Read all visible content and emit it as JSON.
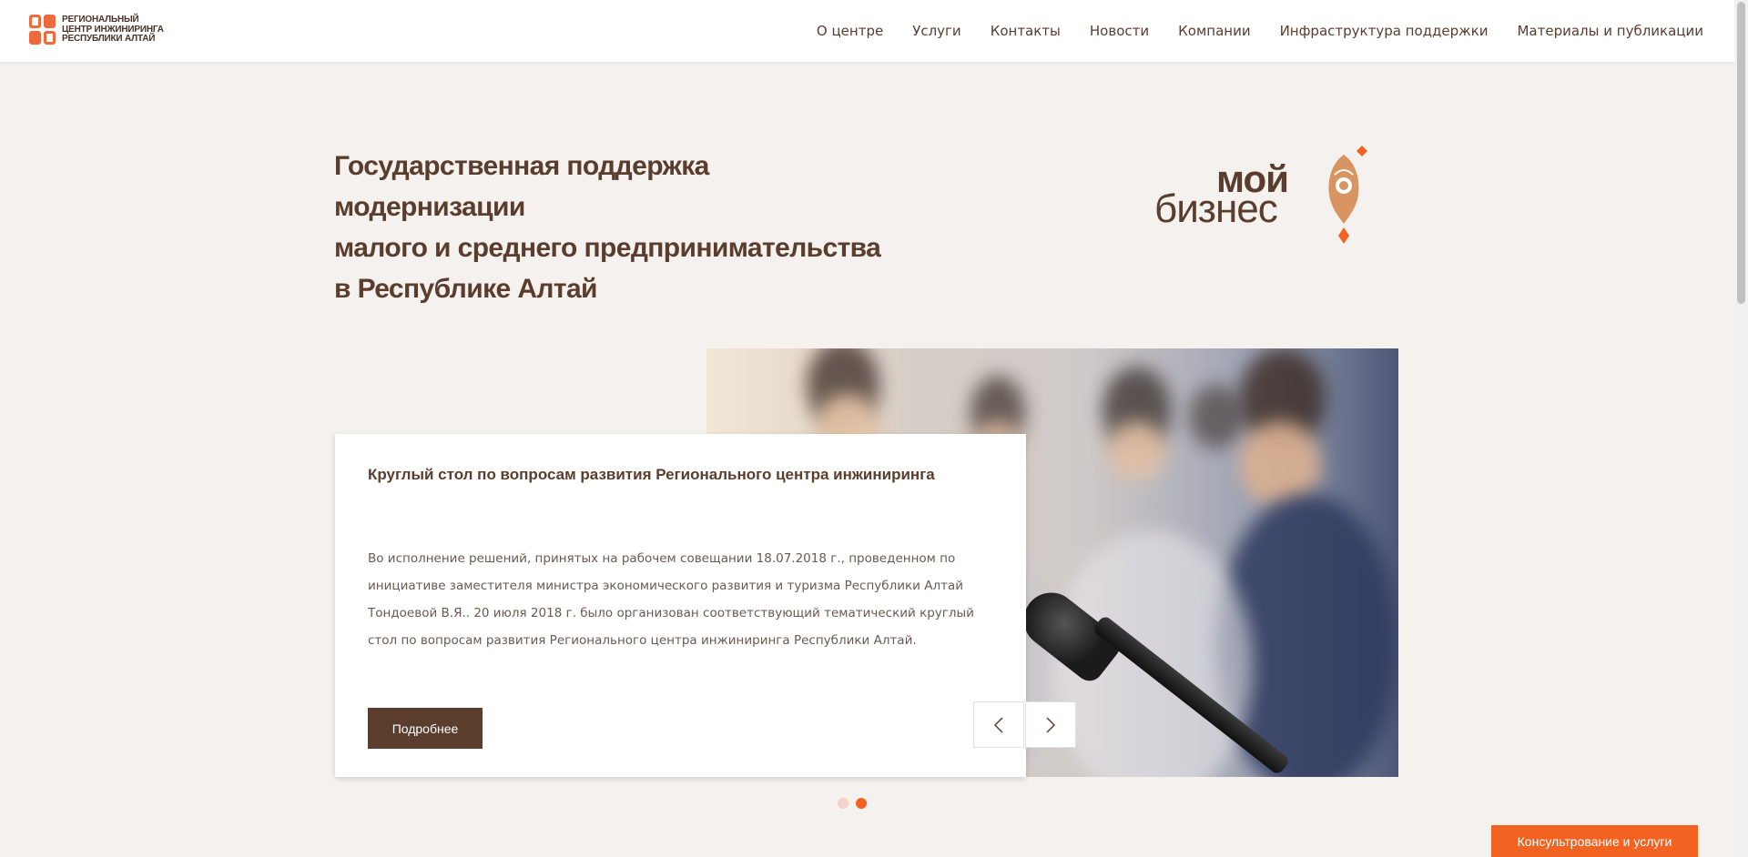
{
  "header": {
    "logo_lines": [
      "РЕГИОНАЛЬНЫЙ",
      "ЦЕНТР ИНЖИНИРИНГА",
      "РЕСПУБЛИКИ АЛТАЙ"
    ],
    "nav": [
      {
        "label": "О центре"
      },
      {
        "label": "Услуги"
      },
      {
        "label": "Контакты"
      },
      {
        "label": "Новости"
      },
      {
        "label": "Компании"
      },
      {
        "label": "Инфраструктура поддержки"
      },
      {
        "label": "Материалы и публикации"
      }
    ]
  },
  "hero": {
    "title_lines": [
      "Государственная поддержка модернизации",
      "малого и среднего предпринимательства",
      "в Республике Алтай"
    ],
    "brand": {
      "word1": "мой",
      "word2": "бизнес"
    }
  },
  "slider": {
    "title": "Круглый стол по вопросам развития Регионального центра инжиниринга",
    "text": "Во исполнение решений, принятых на рабочем совещании 18.07.2018 г., проведенном по инициативе заместителя министра экономического развития и туризма Республики Алтай Тондоевой В.Я.. 20 июля 2018 г. было организован соответствующий тематический круглый стол по вопросам развития Регионального центра инжиниринга Республики Алтай.",
    "more_label": "Подробнее",
    "prev_icon": "chevron-left-icon",
    "next_icon": "chevron-right-icon",
    "active_dot": 2,
    "dot_count": 2
  },
  "consult_button": "Консультрование и услуги",
  "colors": {
    "brown": "#5a3d2d",
    "orange": "#f26322",
    "background": "#f4f1ee"
  }
}
